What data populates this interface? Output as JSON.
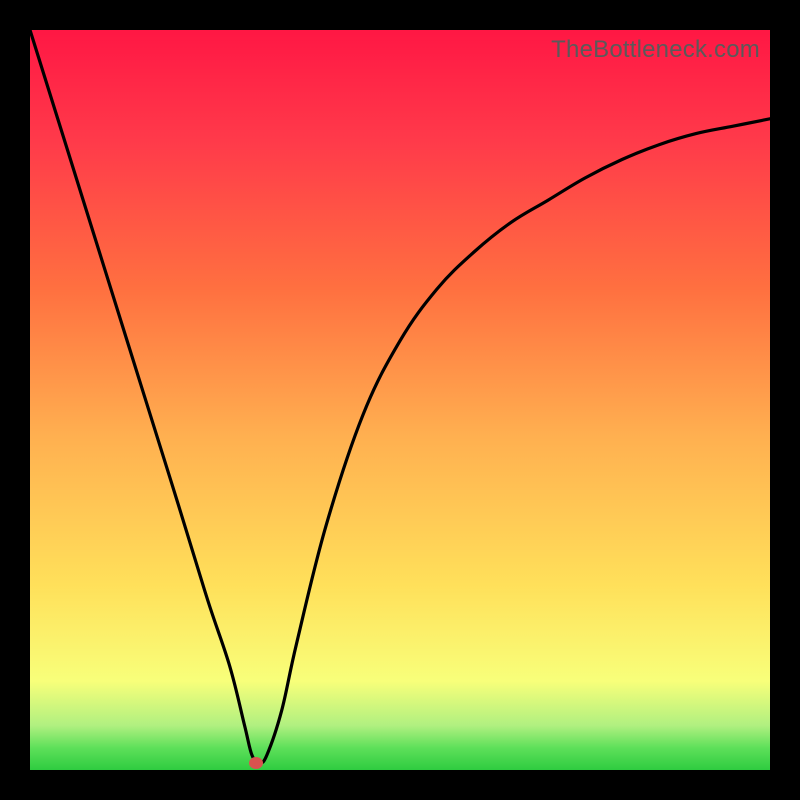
{
  "watermark": "TheBottleneck.com",
  "colors": {
    "frame": "#000000",
    "curve": "#000000",
    "dot": "#d9534f"
  },
  "chart_data": {
    "type": "line",
    "title": "",
    "xlabel": "",
    "ylabel": "",
    "x_range": [
      0,
      100
    ],
    "y_range": [
      0,
      100
    ],
    "series": [
      {
        "name": "bottleneck-curve",
        "x": [
          0,
          5,
          10,
          15,
          20,
          24,
          27,
          29,
          30,
          31,
          32,
          34,
          36,
          40,
          45,
          50,
          55,
          60,
          65,
          70,
          75,
          80,
          85,
          90,
          95,
          100
        ],
        "values": [
          100,
          84,
          68,
          52,
          36,
          23,
          14,
          6,
          2,
          1,
          2,
          8,
          17,
          33,
          48,
          58,
          65,
          70,
          74,
          77,
          80,
          82.5,
          84.5,
          86,
          87,
          88
        ]
      }
    ],
    "marker": {
      "x": 30.5,
      "y": 1
    },
    "gradient_stops": [
      {
        "pct": 0,
        "color": "#2ecc40"
      },
      {
        "pct": 3,
        "color": "#5ee05a"
      },
      {
        "pct": 6,
        "color": "#b0f080"
      },
      {
        "pct": 12,
        "color": "#f8ff7a"
      },
      {
        "pct": 25,
        "color": "#ffe05a"
      },
      {
        "pct": 45,
        "color": "#ffb050"
      },
      {
        "pct": 65,
        "color": "#ff7040"
      },
      {
        "pct": 85,
        "color": "#ff3a4a"
      },
      {
        "pct": 100,
        "color": "#ff1744"
      }
    ]
  }
}
